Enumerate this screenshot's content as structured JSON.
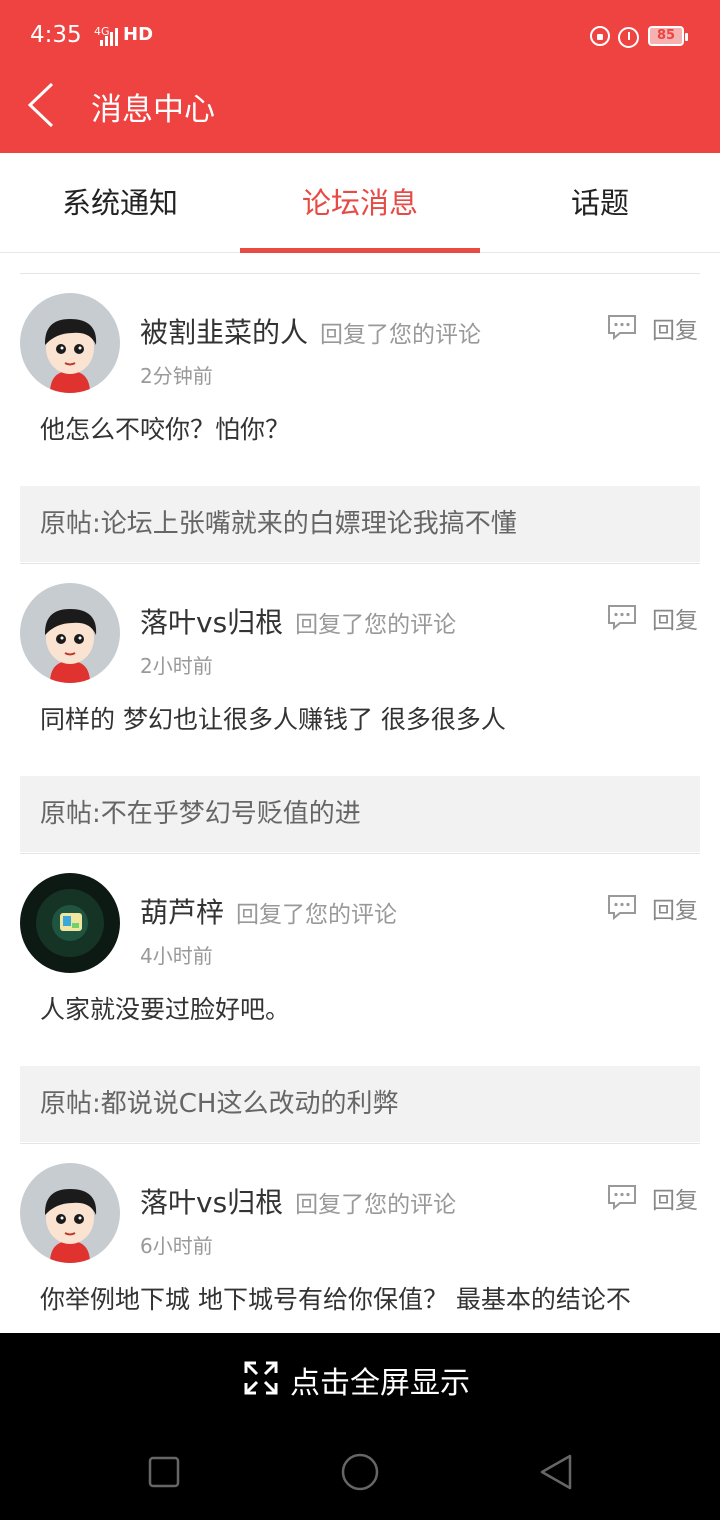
{
  "status": {
    "time": "4:35",
    "signal": "4G",
    "hd": "HD",
    "battery": "85"
  },
  "header": {
    "title": "消息中心"
  },
  "tabs": [
    {
      "label": "系统通知",
      "active": false
    },
    {
      "label": "论坛消息",
      "active": true
    },
    {
      "label": "话题",
      "active": false
    }
  ],
  "messages": [
    {
      "user": "被割韭菜的人",
      "action": "回复了您的评论",
      "time": "2分钟前",
      "reply_label": "回复",
      "comment": "他怎么不咬你？怕你？",
      "original": "原帖:论坛上张嘴就来的白嫖理论我搞不懂",
      "avatar": "cartoon-boy"
    },
    {
      "user": "落叶vs归根",
      "action": "回复了您的评论",
      "time": "2小时前",
      "reply_label": "回复",
      "comment": "同样的 梦幻也让很多人赚钱了 很多很多人",
      "original": "原帖:不在乎梦幻号贬值的进",
      "avatar": "cartoon-boy"
    },
    {
      "user": "葫芦梓",
      "action": "回复了您的评论",
      "time": "4小时前",
      "reply_label": "回复",
      "comment": "人家就没要过脸好吧。",
      "original": "原帖:都说说CH这么改动的利弊",
      "avatar": "dark-game"
    },
    {
      "user": "落叶vs归根",
      "action": "回复了您的评论",
      "time": "6小时前",
      "reply_label": "回复",
      "comment": "你举例地下城 地下城号有给你保值？ 最基本的结论不",
      "original": "",
      "avatar": "cartoon-boy"
    }
  ],
  "fullscreen": {
    "label": "点击全屏显示"
  },
  "colors": {
    "brand": "#ee4341",
    "tab_active": "#e84a45"
  }
}
